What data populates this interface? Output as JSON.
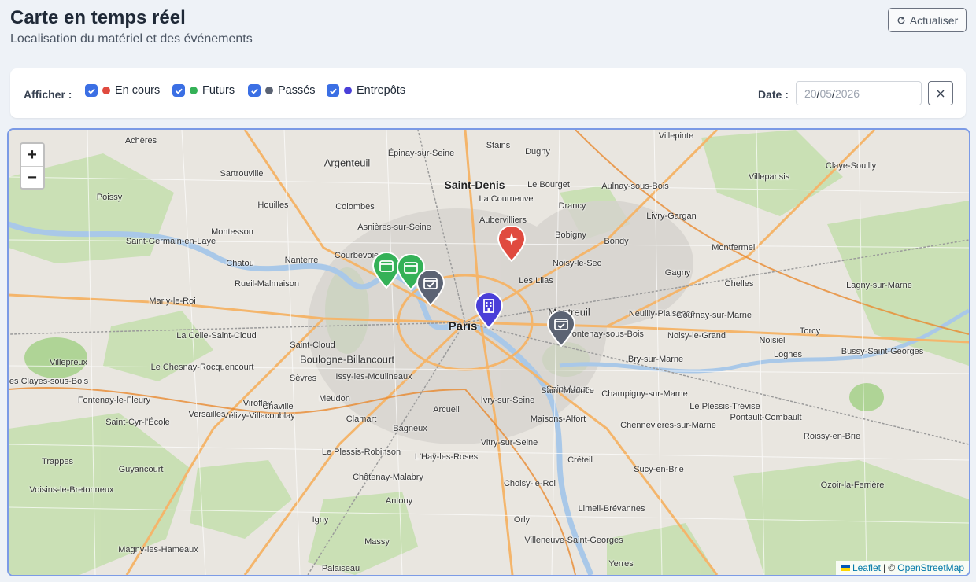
{
  "header": {
    "title": "Carte en temps réel",
    "subtitle": "Localisation du matériel et des événements",
    "refresh_label": "Actualiser"
  },
  "filters": {
    "label": "Afficher :",
    "items": [
      {
        "label": "En cours",
        "color": "#e04a3f",
        "checked": true
      },
      {
        "label": "Futurs",
        "color": "#34b157",
        "checked": true
      },
      {
        "label": "Passés",
        "color": "#5b6373",
        "checked": true
      },
      {
        "label": "Entrepôts",
        "color": "#4a3fd8",
        "checked": true
      }
    ],
    "date_label": "Date :",
    "date_value": {
      "day": "20",
      "month": "05",
      "year": "2026"
    }
  },
  "map": {
    "zoom_in": "+",
    "zoom_out": "−",
    "places": [
      "Argenteuil",
      "Saint-Denis",
      "Paris",
      "Montreuil",
      "Boulogne-Billancourt",
      "Nanterre",
      "Courbevoie",
      "Colombes",
      "Aubervilliers",
      "Bobigny",
      "Bondy",
      "Drancy",
      "Villepinte",
      "Aulnay-sous-Bois",
      "Livry-Gargan",
      "Montfermeil",
      "Chelles",
      "Gagny",
      "Noisy-le-Grand",
      "Torcy",
      "Lognes",
      "Versailles",
      "Vélizy-Villacoublay",
      "Saint-Cloud",
      "Issy-les-Moulineaux",
      "Clamart",
      "Meudon",
      "Sèvres",
      "Vitry-sur-Seine",
      "Ivry-sur-Seine",
      "Créteil",
      "Saint-Maur",
      "Champigny-sur-Marne",
      "Massy",
      "Orly",
      "Antony",
      "Palaiseau",
      "Le Bourget",
      "Villeparisis",
      "Claye-Souilly",
      "Sartrouville",
      "Houilles",
      "Chatou",
      "Rueil-Malmaison",
      "Saint-Germain-en-Laye",
      "Poissy",
      "Trappes",
      "Guyancourt",
      "Stains",
      "Dugny",
      "La Courneuve",
      "Les Lilas",
      "Noisy-le-Sec",
      "Fontenay-sous-Bois",
      "Neuilly-Plaisance",
      "Bry-sur-Marne",
      "Bagneux",
      "L'Haÿ-les-Roses",
      "Choisy-le-Roi",
      "Châtenay-Malabry",
      "Le Plessis-Robinson",
      "Villeneuve-Saint-Georges",
      "Limeil-Brévannes",
      "Sucy-en-Brie",
      "Pontault-Combault",
      "Roissy-en-Brie",
      "Ozoir-la-Ferrière",
      "Lagny-sur-Marne",
      "Bussy-Saint-Georges",
      "Yerres",
      "Igny",
      "Marly-le-Roi",
      "Achères",
      "Montesson",
      "Le Chesnay-Rocquencourt",
      "La Celle-Saint-Cloud",
      "Les Clayes-sous-Bois",
      "Villepreux",
      "Fontenay-le-Fleury",
      "Saint-Cyr-l'École",
      "Voisins-le-Bretonneux",
      "Magny-les-Hameaux",
      "Arcueil",
      "Viroflay",
      "Chaville",
      "Épinay-sur-Seine",
      "Asnières-sur-Seine",
      "Maisons-Alfort",
      "Saint-Maurice",
      "Noisiel",
      "Gournay-sur-Marne",
      "Le Plessis-Trévise",
      "Chennevières-sur-Marne"
    ],
    "attribution": {
      "leaflet": "Leaflet",
      "separator": "| ©",
      "osm": "OpenStreetMap"
    },
    "markers": [
      {
        "status": "En cours",
        "icon": "sparkle-icon",
        "color": "#e04a3f"
      },
      {
        "status": "Futurs",
        "icon": "calendar-icon",
        "color": "#34b157"
      },
      {
        "status": "Futurs",
        "icon": "calendar-icon",
        "color": "#34b157"
      },
      {
        "status": "Passés",
        "icon": "calendar-check-icon",
        "color": "#5b6373"
      },
      {
        "status": "Passés",
        "icon": "calendar-check-icon",
        "color": "#5b6373"
      },
      {
        "status": "Entrepôts",
        "icon": "building-icon",
        "color": "#4a3fd8"
      }
    ]
  }
}
